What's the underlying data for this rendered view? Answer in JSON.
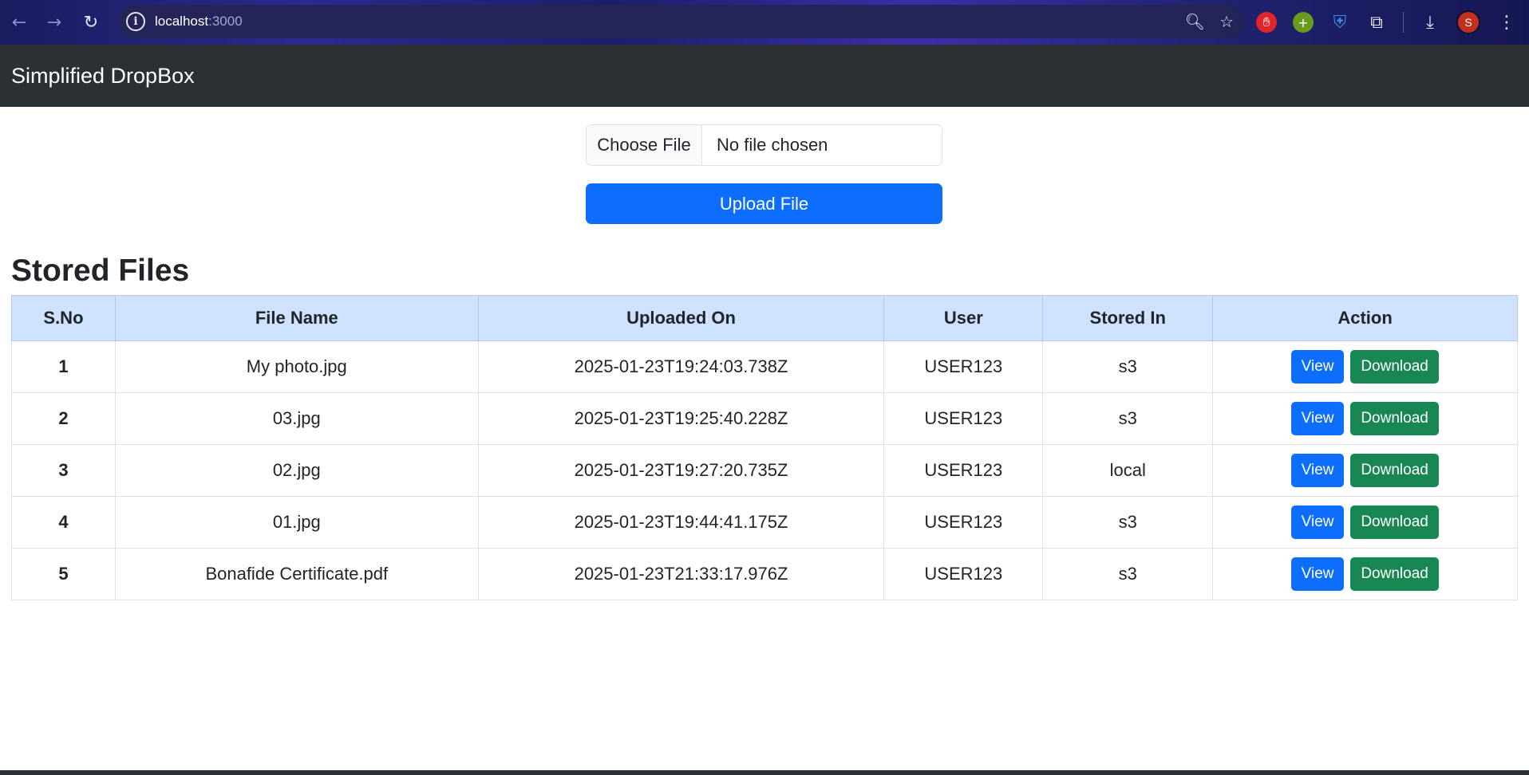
{
  "browser": {
    "url_host": "localhost",
    "url_port": ":3000",
    "avatar_letter": "S"
  },
  "navbar": {
    "brand": "Simplified DropBox"
  },
  "upload": {
    "choose_label": "Choose File",
    "file_status": "No file chosen",
    "upload_label": "Upload File"
  },
  "files_section": {
    "title": "Stored Files",
    "headers": [
      "S.No",
      "File Name",
      "Uploaded On",
      "User",
      "Stored In",
      "Action"
    ],
    "view_label": "View",
    "download_label": "Download",
    "rows": [
      {
        "sno": "1",
        "name": "My photo.jpg",
        "uploaded": "2025-01-23T19:24:03.738Z",
        "user": "USER123",
        "stored": "s3"
      },
      {
        "sno": "2",
        "name": "03.jpg",
        "uploaded": "2025-01-23T19:25:40.228Z",
        "user": "USER123",
        "stored": "s3"
      },
      {
        "sno": "3",
        "name": "02.jpg",
        "uploaded": "2025-01-23T19:27:20.735Z",
        "user": "USER123",
        "stored": "local"
      },
      {
        "sno": "4",
        "name": "01.jpg",
        "uploaded": "2025-01-23T19:44:41.175Z",
        "user": "USER123",
        "stored": "s3"
      },
      {
        "sno": "5",
        "name": "Bonafide Certificate.pdf",
        "uploaded": "2025-01-23T21:33:17.976Z",
        "user": "USER123",
        "stored": "s3"
      }
    ]
  },
  "colors": {
    "primary": "#0d6efd",
    "success": "#198754",
    "navbar": "#2b3035",
    "table_header": "#cfe2ff"
  },
  "icons": [
    "back-arrow-icon",
    "forward-arrow-icon",
    "reload-icon",
    "site-info-icon",
    "zoom-icon",
    "star-icon",
    "extension-icon",
    "download-icon",
    "menu-icon"
  ]
}
